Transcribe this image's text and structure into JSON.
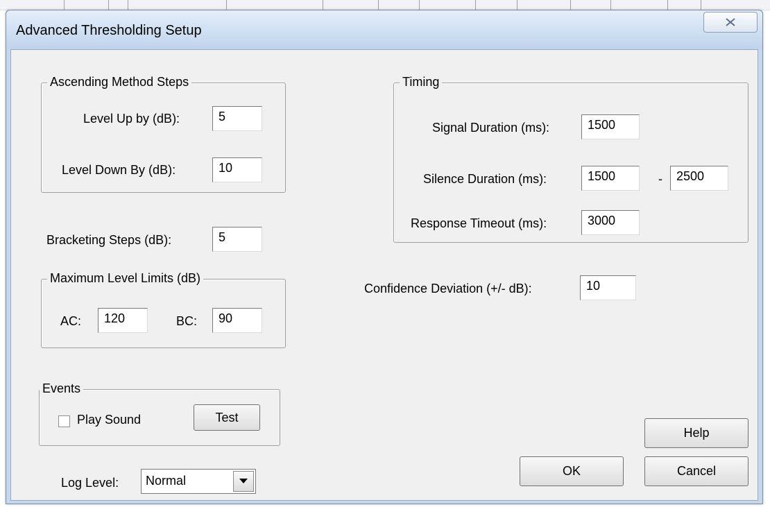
{
  "window": {
    "title": "Advanced Thresholding Setup",
    "close_icon": "close-icon"
  },
  "ascending": {
    "legend": "Ascending Method Steps",
    "level_up_label": "Level Up by (dB):",
    "level_up_value": "5",
    "level_down_label": "Level Down By (dB):",
    "level_down_value": "10"
  },
  "bracketing": {
    "label": "Bracketing Steps (dB):",
    "value": "5"
  },
  "max_limits": {
    "legend": "Maximum Level Limits (dB)",
    "ac_label": "AC:",
    "ac_value": "120",
    "bc_label": "BC:",
    "bc_value": "90"
  },
  "events": {
    "legend": "Events",
    "play_sound_label": "Play Sound",
    "play_sound_checked": false,
    "test_label": "Test"
  },
  "log_level": {
    "label": "Log Level:",
    "selected": "Normal"
  },
  "timing": {
    "legend": "Timing",
    "signal_label": "Signal Duration (ms):",
    "signal_value": "1500",
    "silence_label": "Silence Duration (ms):",
    "silence_min": "1500",
    "silence_sep": "-",
    "silence_max": "2500",
    "response_label": "Response Timeout (ms):",
    "response_value": "3000"
  },
  "confidence": {
    "label": "Confidence Deviation (+/- dB):",
    "value": "10"
  },
  "buttons": {
    "help": "Help",
    "ok": "OK",
    "cancel": "Cancel"
  }
}
